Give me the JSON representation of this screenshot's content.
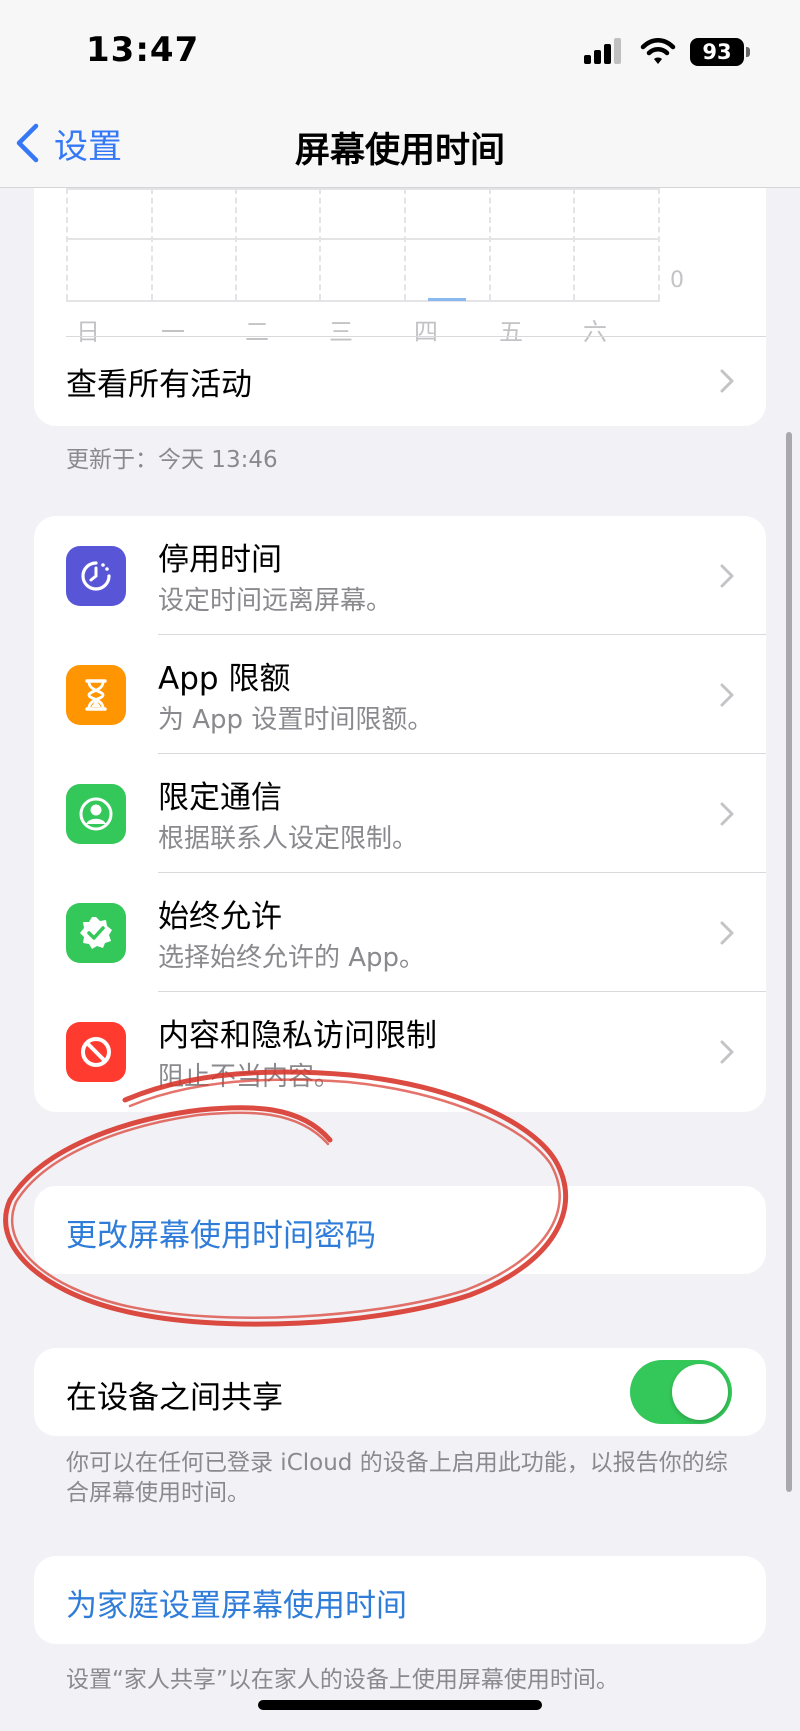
{
  "status_bar": {
    "time": "13:47",
    "battery": "93"
  },
  "nav": {
    "back_label": "设置",
    "title": "屏幕使用时间"
  },
  "chart_data": {
    "type": "bar",
    "categories": [
      "日",
      "一",
      "二",
      "三",
      "四",
      "五",
      "六"
    ],
    "values": [
      0,
      0,
      0,
      0,
      0,
      0,
      0
    ],
    "ytick_label": "0"
  },
  "activity": {
    "see_all_label": "查看所有活动",
    "updated_text": "更新于：今天 13:46"
  },
  "features": [
    {
      "title": "停用时间",
      "subtitle": "设定时间远离屏幕。",
      "icon": "downtime-icon",
      "color": "#5856d6"
    },
    {
      "title": "App 限额",
      "subtitle": "为 App 设置时间限额。",
      "icon": "hourglass-icon",
      "color": "#ff9500"
    },
    {
      "title": "限定通信",
      "subtitle": "根据联系人设定限制。",
      "icon": "contact-icon",
      "color": "#34c759"
    },
    {
      "title": "始终允许",
      "subtitle": "选择始终允许的 App。",
      "icon": "checkmark-badge-icon",
      "color": "#34c759"
    },
    {
      "title": "内容和隐私访问限制",
      "subtitle": "阻止不当内容。",
      "icon": "prohibited-icon",
      "color": "#ff3b30"
    }
  ],
  "passcode": {
    "label": "更改屏幕使用时间密码"
  },
  "share": {
    "label": "在设备之间共享",
    "enabled": true,
    "note": "你可以在任何已登录 iCloud 的设备上启用此功能，以报告你的综合屏幕使用时间。"
  },
  "family": {
    "label": "为家庭设置屏幕使用时间",
    "note": "设置“家人共享”以在家人的设备上使用屏幕使用时间。"
  },
  "colors": {
    "accent": "#3478f6",
    "link": "#2f7dd8",
    "toggle_on": "#34c759",
    "annotation": "#d8372c"
  }
}
